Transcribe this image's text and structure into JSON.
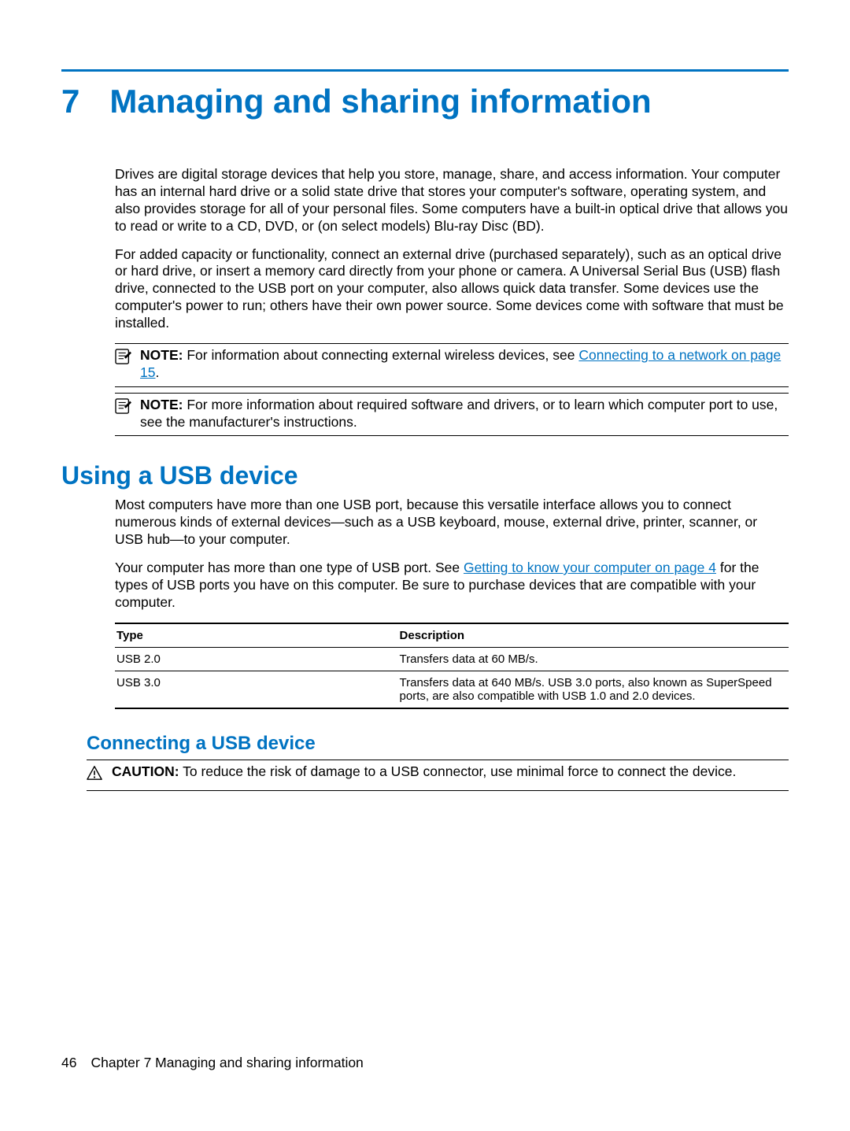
{
  "chapter": {
    "number": "7",
    "title": "Managing and sharing information"
  },
  "intro": {
    "p1": "Drives are digital storage devices that help you store, manage, share, and access information. Your computer has an internal hard drive or a solid state drive that stores your computer's software, operating system, and also provides storage for all of your personal files. Some computers have a built-in optical drive that allows you to read or write to a CD, DVD, or (on select models) Blu-ray Disc (BD).",
    "p2": "For added capacity or functionality, connect an external drive (purchased separately), such as an optical drive or hard drive, or insert a memory card directly from your phone or camera. A Universal Serial Bus (USB) flash drive, connected to the USB port on your computer, also allows quick data transfer. Some devices use the computer's power to run; others have their own power source. Some devices come with software that must be installed."
  },
  "notes": [
    {
      "label": "NOTE:",
      "pre": "For information about connecting external wireless devices, see ",
      "link": "Connecting to a network on page 15",
      "post": "."
    },
    {
      "label": "NOTE:",
      "pre": "For more information about required software and drivers, or to learn which computer port to use, see the manufacturer's instructions.",
      "link": "",
      "post": ""
    }
  ],
  "usb_section": {
    "title": "Using a USB device",
    "p1": "Most computers have more than one USB port, because this versatile interface allows you to connect numerous kinds of external devices—such as a USB keyboard, mouse, external drive, printer, scanner, or USB hub—to your computer.",
    "p2_pre": "Your computer has more than one type of USB port. See ",
    "p2_link": "Getting to know your computer on page 4",
    "p2_post": " for the types of USB ports you have on this computer. Be sure to purchase devices that are compatible with your computer.",
    "table": {
      "headers": {
        "type": "Type",
        "desc": "Description"
      },
      "rows": [
        {
          "type": "USB 2.0",
          "desc": "Transfers data at 60 MB/s."
        },
        {
          "type": "USB 3.0",
          "desc": "Transfers data at 640 MB/s. USB 3.0 ports, also known as SuperSpeed ports, are also compatible with USB 1.0 and 2.0 devices."
        }
      ]
    }
  },
  "connecting": {
    "title": "Connecting a USB device",
    "caution_label": "CAUTION:",
    "caution_text": "To reduce the risk of damage to a USB connector, use minimal force to connect the device."
  },
  "footer": {
    "page": "46",
    "chapter_ref": "Chapter 7   Managing and sharing information"
  }
}
